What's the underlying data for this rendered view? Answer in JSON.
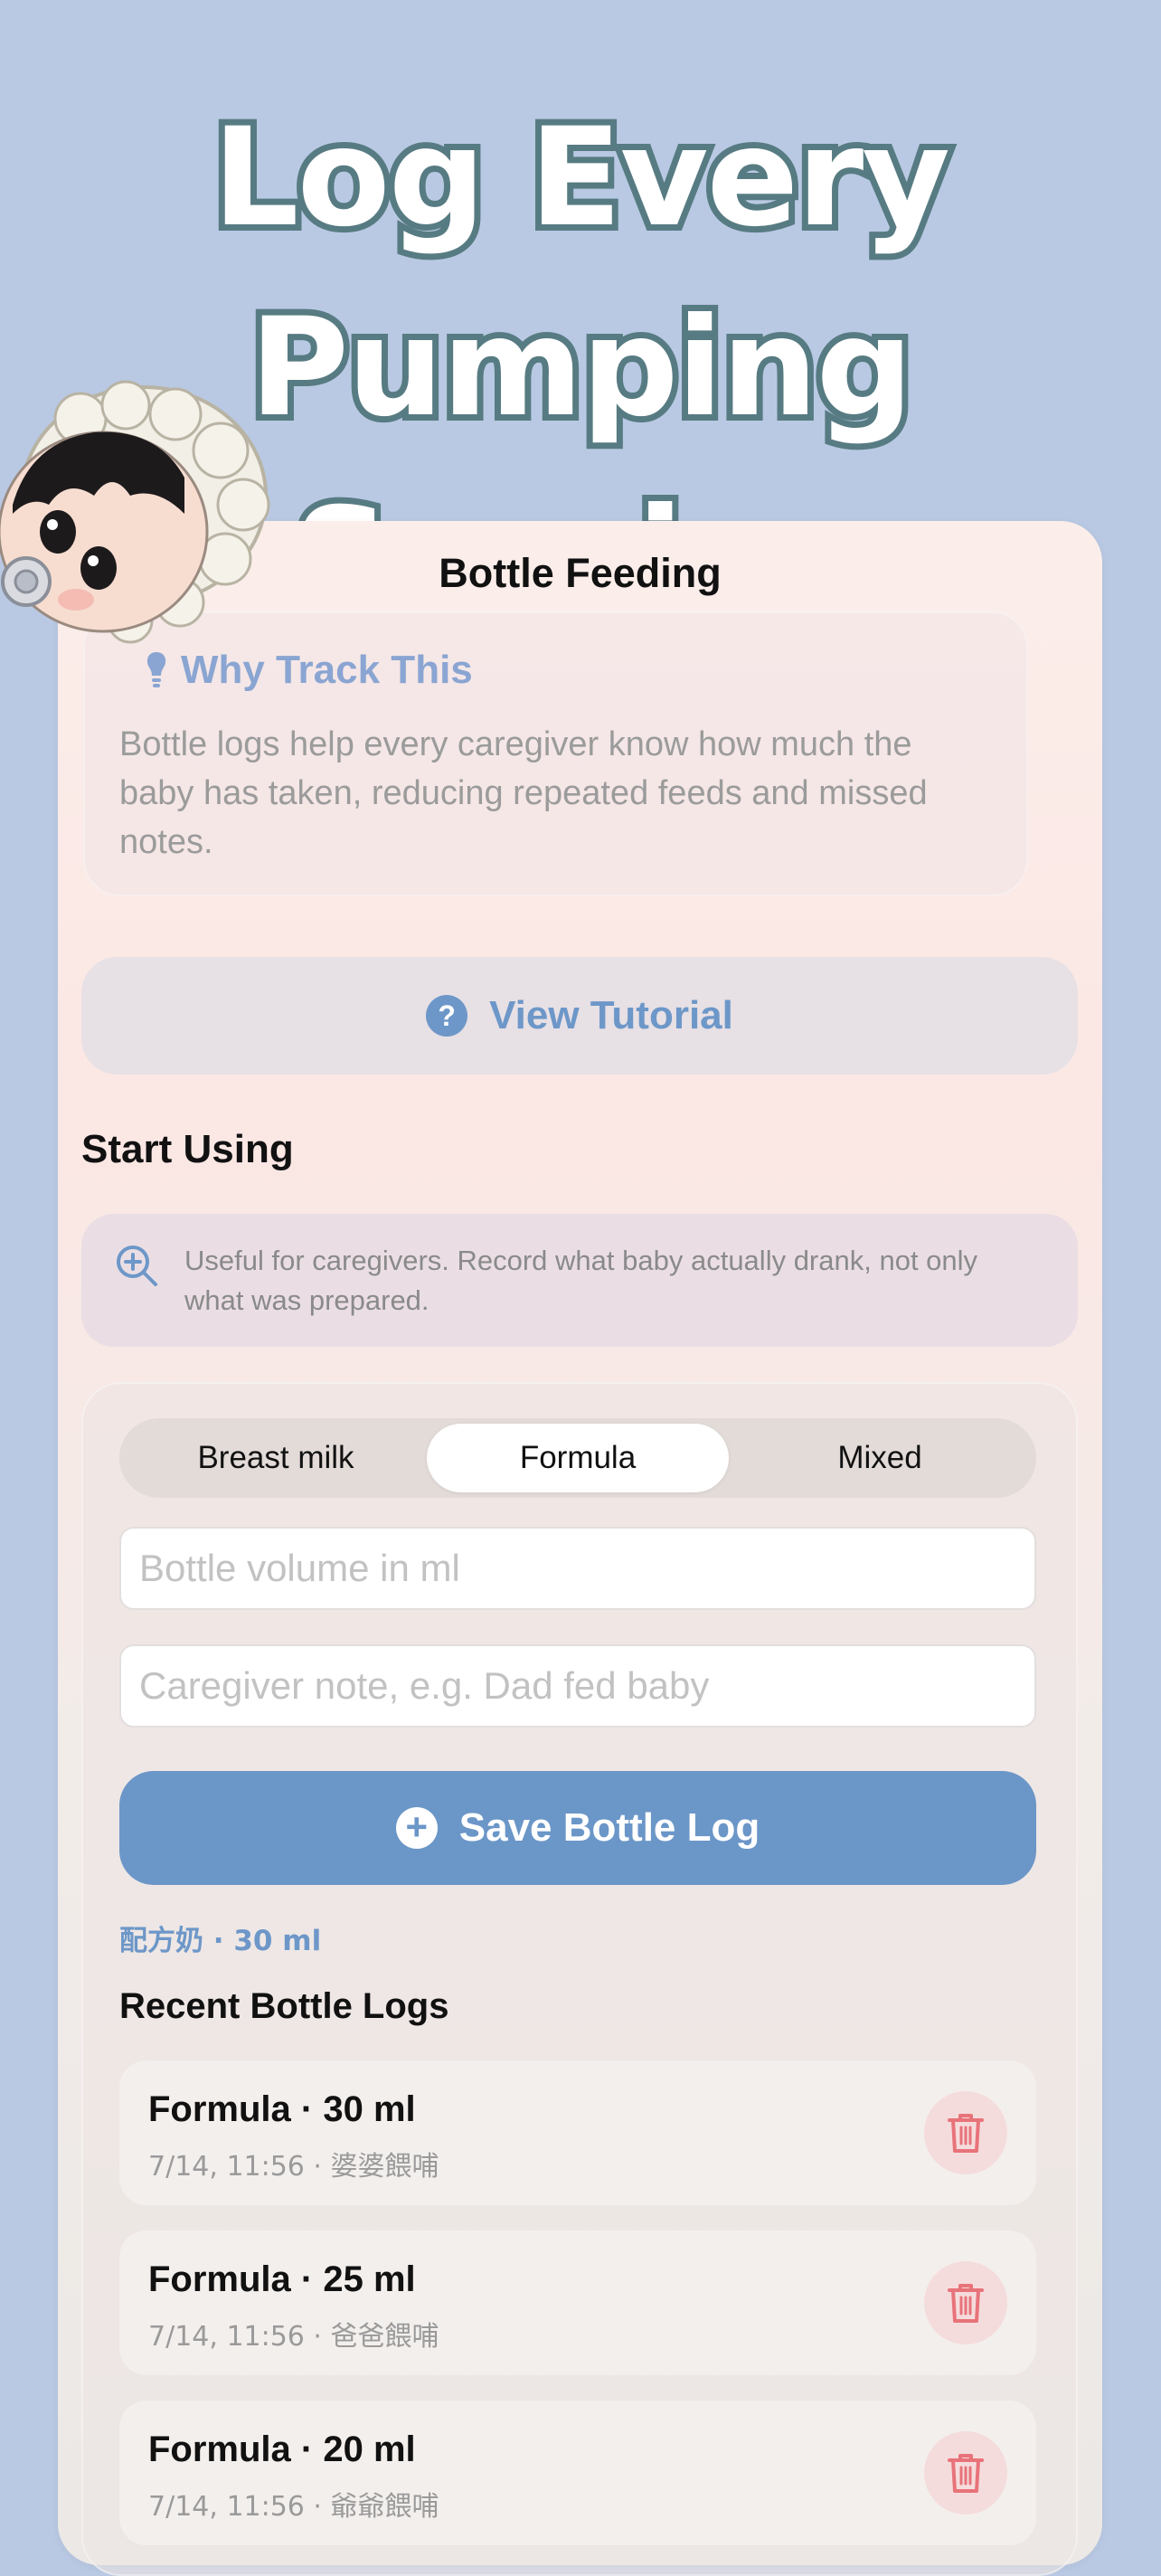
{
  "headline": {
    "line1": "Log Every",
    "line2": "Pumping Session"
  },
  "screen": {
    "title": "Bottle Feeding"
  },
  "why": {
    "title": "Why Track This",
    "body": "Bottle logs help every caregiver know how much the baby has taken, reducing repeated feeds and missed notes."
  },
  "tutorial": {
    "label": "View Tutorial",
    "icon": "question-circle-icon"
  },
  "start": {
    "title": "Start Using",
    "tip": "Useful for caregivers. Record what baby actually drank, not only what was prepared."
  },
  "form": {
    "segments": [
      {
        "label": "Breast milk",
        "selected": false
      },
      {
        "label": "Formula",
        "selected": true
      },
      {
        "label": "Mixed",
        "selected": false
      }
    ],
    "volume_placeholder": "Bottle volume in ml",
    "note_placeholder": "Caregiver note, e.g. Dad fed baby",
    "save_label": "Save Bottle Log",
    "summary": "配方奶 · 30 ml"
  },
  "recent": {
    "title": "Recent Bottle Logs",
    "items": [
      {
        "title": "Formula · 30 ml",
        "subtitle": "7/14, 11:56 · 婆婆餵哺"
      },
      {
        "title": "Formula · 25 ml",
        "subtitle": "7/14, 11:56 · 爸爸餵哺"
      },
      {
        "title": "Formula · 20 ml",
        "subtitle": "7/14, 11:56 · 爺爺餵哺"
      }
    ]
  },
  "colors": {
    "background": "#b9c9e3",
    "accent": "#6b96c8",
    "headline_outline": "#577b82",
    "delete": "#e8737a"
  }
}
